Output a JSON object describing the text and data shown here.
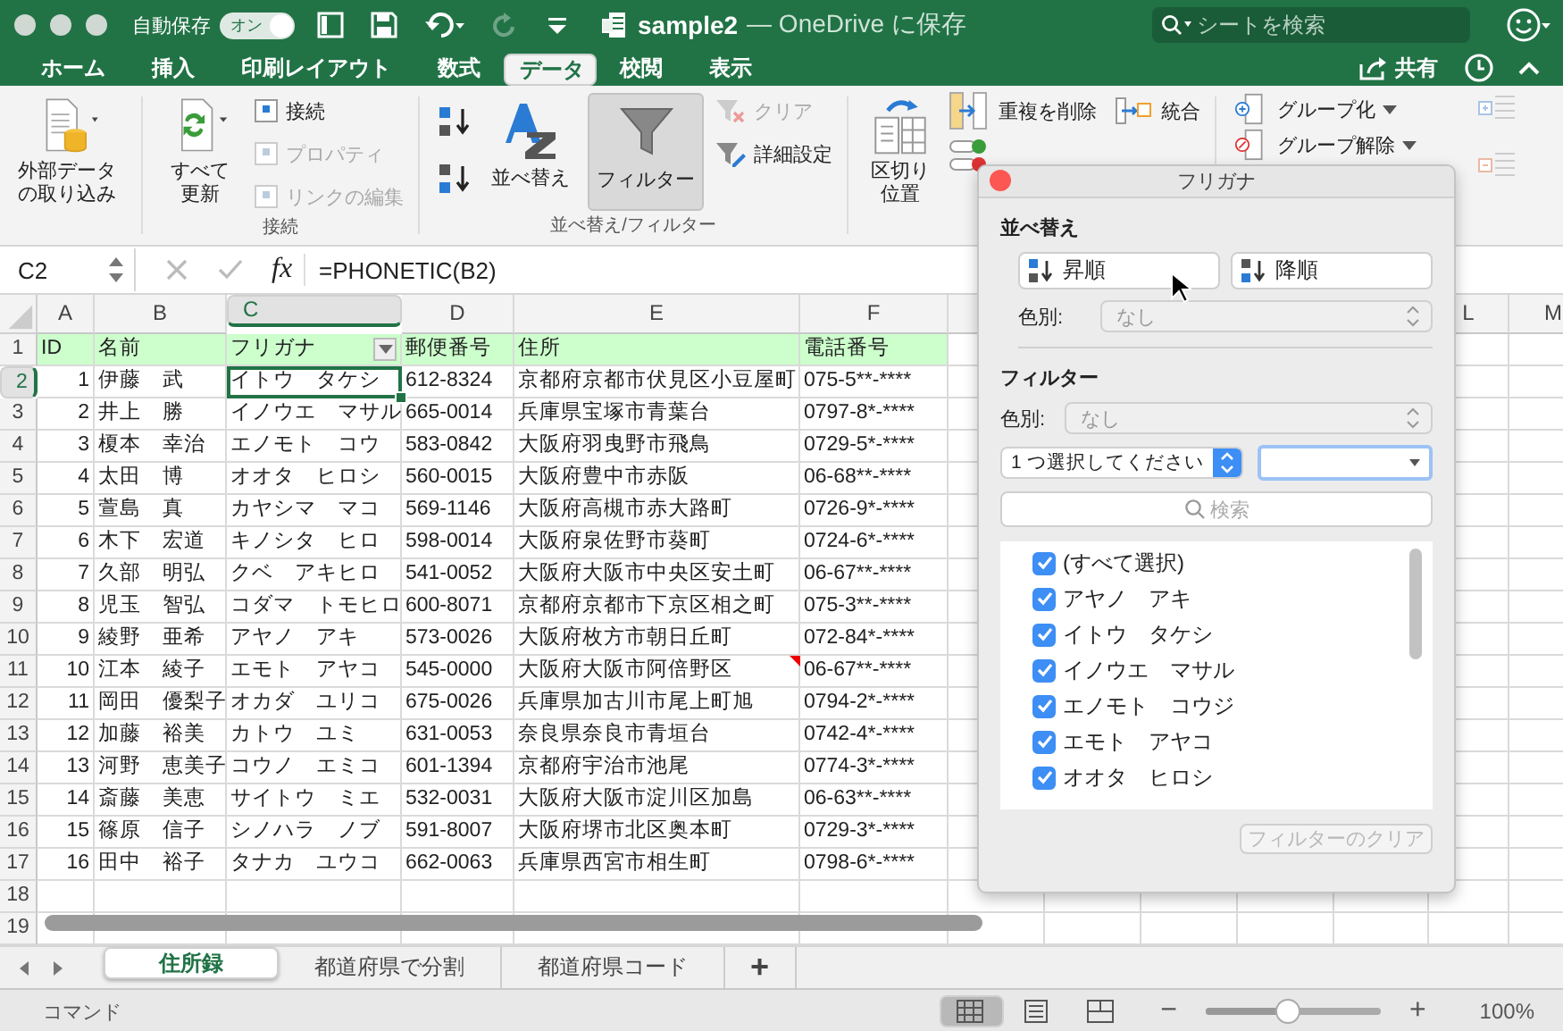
{
  "title_bar": {
    "autosave_label": "自動保存",
    "autosave_toggle": {
      "label": "オン",
      "on": true
    },
    "document": "sample2",
    "location": "— OneDrive に保存",
    "search": {
      "placeholder": "シートを検索"
    }
  },
  "ribbon_tabs": [
    {
      "label": "ホーム",
      "selected": false
    },
    {
      "label": "挿入",
      "selected": false
    },
    {
      "label": "印刷レイアウト",
      "selected": false
    },
    {
      "label": "数式",
      "selected": false
    },
    {
      "label": "データ",
      "selected": true
    },
    {
      "label": "校閲",
      "selected": false
    },
    {
      "label": "表示",
      "selected": false
    }
  ],
  "share": "共有",
  "ribbon": {
    "external_data": [
      "外部データ",
      "の取り込み"
    ],
    "refresh_all": [
      "すべて",
      "更新"
    ],
    "connections": [
      {
        "label": "接続",
        "disabled": false
      },
      {
        "label": "プロパティ",
        "disabled": true
      },
      {
        "label": "リンクの編集",
        "disabled": true
      }
    ],
    "connections_group": "接続",
    "sort": "並べ替え",
    "filter": {
      "label": "フィルター",
      "pressed": true
    },
    "clear": {
      "label": "クリア",
      "disabled": true
    },
    "advanced": {
      "label": "詳細設定",
      "disabled": false
    },
    "sort_filter_group": "並べ替え/フィルター",
    "text_to_columns": [
      "区切り",
      "位置"
    ],
    "remove_duplicates": "重複を削除",
    "consolidate": "統合",
    "group": "グループ化",
    "ungroup": "グループ解除"
  },
  "formula_bar": {
    "name_box": "C2",
    "fx": "fx",
    "formula": "=PHONETIC(B2)"
  },
  "sheet": {
    "columns": [
      {
        "label": "A",
        "selected": false,
        "filter": false
      },
      {
        "label": "B",
        "selected": false,
        "filter": false
      },
      {
        "label": "C",
        "selected": true,
        "filter": true
      },
      {
        "label": "D",
        "selected": false,
        "filter": false
      },
      {
        "label": "E",
        "selected": false,
        "filter": false
      },
      {
        "label": "F",
        "selected": false,
        "filter": false
      },
      {
        "label": "L",
        "selected": false,
        "filter": false
      },
      {
        "label": "M",
        "selected": false,
        "filter": false
      }
    ],
    "rows": [
      {
        "label": "1",
        "kind": "header",
        "selected": false,
        "note": false,
        "cells": [
          "ID",
          "名前",
          "フリガナ",
          "郵便番号",
          "住所",
          "電話番号"
        ]
      },
      {
        "label": "2",
        "kind": "data",
        "selected": true,
        "note": false,
        "cells": [
          "1",
          "伊藤　武",
          "イトウ　タケシ",
          "612-8324",
          "京都府京都市伏見区小豆屋町",
          "075-5**-****"
        ]
      },
      {
        "label": "3",
        "kind": "data",
        "selected": false,
        "note": false,
        "cells": [
          "2",
          "井上　勝",
          "イノウエ　マサル",
          "665-0014",
          "兵庫県宝塚市青葉台",
          "0797-8*-****"
        ]
      },
      {
        "label": "4",
        "kind": "data",
        "selected": false,
        "note": false,
        "cells": [
          "3",
          "榎本　幸治",
          "エノモト　コウ",
          "583-0842",
          "大阪府羽曳野市飛鳥",
          "0729-5*-****"
        ]
      },
      {
        "label": "5",
        "kind": "data",
        "selected": false,
        "note": false,
        "cells": [
          "4",
          "太田　博",
          "オオタ　ヒロシ",
          "560-0015",
          "大阪府豊中市赤阪",
          "06-68**-****"
        ]
      },
      {
        "label": "6",
        "kind": "data",
        "selected": false,
        "note": false,
        "cells": [
          "5",
          "萱島　真",
          "カヤシマ　マコ",
          "569-1146",
          "大阪府高槻市赤大路町",
          "0726-9*-****"
        ]
      },
      {
        "label": "7",
        "kind": "data",
        "selected": false,
        "note": false,
        "cells": [
          "6",
          "木下　宏道",
          "キノシタ　ヒロ",
          "598-0014",
          "大阪府泉佐野市葵町",
          "0724-6*-****"
        ]
      },
      {
        "label": "8",
        "kind": "data",
        "selected": false,
        "note": false,
        "cells": [
          "7",
          "久部　明弘",
          "クベ　アキヒロ",
          "541-0052",
          "大阪府大阪市中央区安土町",
          "06-67**-****"
        ]
      },
      {
        "label": "9",
        "kind": "data",
        "selected": false,
        "note": false,
        "cells": [
          "8",
          "児玉　智弘",
          "コダマ　トモヒロ",
          "600-8071",
          "京都府京都市下京区相之町",
          "075-3**-****"
        ]
      },
      {
        "label": "10",
        "kind": "data",
        "selected": false,
        "note": false,
        "cells": [
          "9",
          "綾野　亜希",
          "アヤノ　アキ",
          "573-0026",
          "大阪府枚方市朝日丘町",
          "072-84*-****"
        ]
      },
      {
        "label": "11",
        "kind": "data",
        "selected": false,
        "note": true,
        "cells": [
          "10",
          "江本　綾子",
          "エモト　アヤコ",
          "545-0000",
          "大阪府大阪市阿倍野区",
          "06-67**-****"
        ]
      },
      {
        "label": "12",
        "kind": "data",
        "selected": false,
        "note": false,
        "cells": [
          "11",
          "岡田　優梨子",
          "オカダ　ユリコ",
          "675-0026",
          "兵庫県加古川市尾上町旭",
          "0794-2*-****"
        ]
      },
      {
        "label": "13",
        "kind": "data",
        "selected": false,
        "note": false,
        "cells": [
          "12",
          "加藤　裕美",
          "カトウ　ユミ",
          "631-0053",
          "奈良県奈良市青垣台",
          "0742-4*-****"
        ]
      },
      {
        "label": "14",
        "kind": "data",
        "selected": false,
        "note": false,
        "cells": [
          "13",
          "河野　恵美子",
          "コウノ　エミコ",
          "601-1394",
          "京都府宇治市池尾",
          "0774-3*-****"
        ]
      },
      {
        "label": "15",
        "kind": "data",
        "selected": false,
        "note": false,
        "cells": [
          "14",
          "斎藤　美恵",
          "サイトウ　ミエ",
          "532-0031",
          "大阪府大阪市淀川区加島",
          "06-63**-****"
        ]
      },
      {
        "label": "16",
        "kind": "data",
        "selected": false,
        "note": false,
        "cells": [
          "15",
          "篠原　信子",
          "シノハラ　ノブ",
          "591-8007",
          "大阪府堺市北区奥本町",
          "0729-3*-****"
        ]
      },
      {
        "label": "17",
        "kind": "data",
        "selected": false,
        "note": false,
        "cells": [
          "16",
          "田中　裕子",
          "タナカ　ユウコ",
          "662-0063",
          "兵庫県西宮市相生町",
          "0798-6*-****"
        ]
      },
      {
        "label": "18",
        "kind": "empty",
        "selected": false,
        "note": false,
        "cells": []
      },
      {
        "label": "19",
        "kind": "empty",
        "selected": false,
        "note": false,
        "cells": []
      }
    ]
  },
  "filter_panel": {
    "title": "フリガナ",
    "sort_heading": "並べ替え",
    "ascending": "昇順",
    "descending": "降順",
    "sort_color_label": "色別:",
    "sort_color_value": "なし",
    "filter_heading": "フィルター",
    "filter_color_label": "色別:",
    "filter_color_value": "なし",
    "condition": "1 つ選択してください",
    "search_placeholder": "検索",
    "items": [
      {
        "label": "(すべて選択)",
        "checked": true
      },
      {
        "label": "アヤノ　アキ",
        "checked": true
      },
      {
        "label": "イトウ　タケシ",
        "checked": true
      },
      {
        "label": "イノウエ　マサル",
        "checked": true
      },
      {
        "label": "エノモト　コウジ",
        "checked": true
      },
      {
        "label": "エモト　アヤコ",
        "checked": true
      },
      {
        "label": "オオタ　ヒロシ",
        "checked": true
      }
    ],
    "clear_button": {
      "label": "フィルターのクリア",
      "disabled": true
    }
  },
  "sheet_tabs": [
    {
      "label": "住所録",
      "selected": true
    },
    {
      "label": "都道府県で分割",
      "selected": false
    },
    {
      "label": "都道府県コード",
      "selected": false
    }
  ],
  "add_sheet": "+",
  "status_bar": {
    "mode": "コマンド",
    "views": [
      {
        "kind": "normal",
        "selected": true
      },
      {
        "kind": "page_layout",
        "selected": false
      },
      {
        "kind": "page_break",
        "selected": false
      }
    ],
    "zoom_minus": "−",
    "zoom_plus": "+",
    "zoom": {
      "level": 0.47
    },
    "zoom_reading": "100%"
  }
}
